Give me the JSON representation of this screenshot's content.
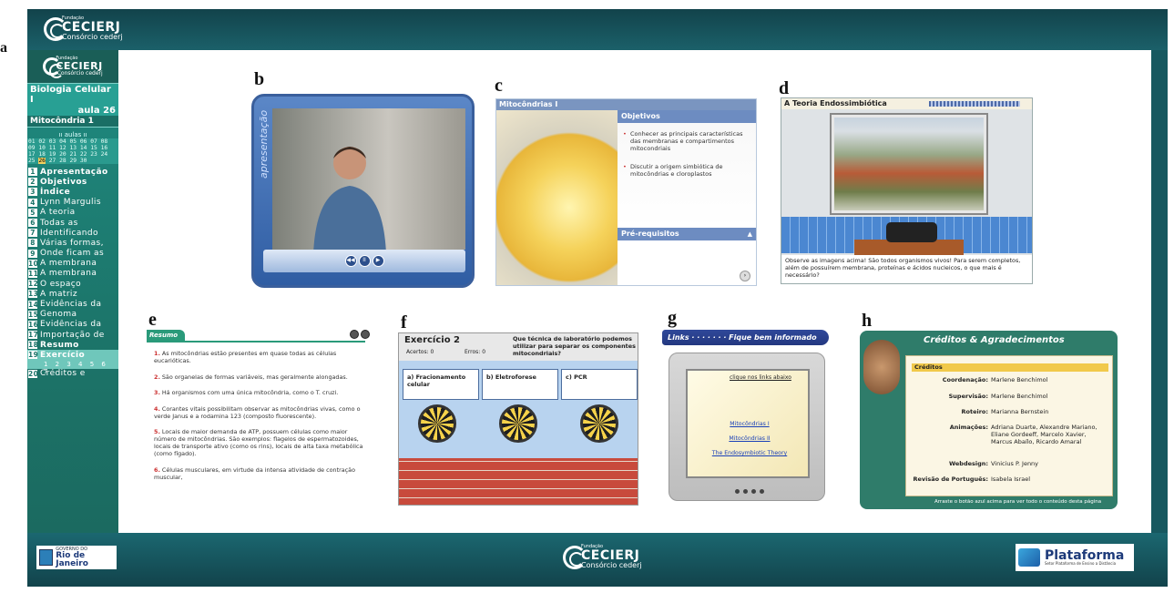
{
  "labels": {
    "a": "a",
    "b": "b",
    "c": "c",
    "d": "d",
    "e": "e",
    "f": "f",
    "g": "g",
    "h": "h"
  },
  "logo": {
    "small": "Fundação",
    "name": "CECIERJ",
    "sub": "Consórcio cederj"
  },
  "sidebar": {
    "course": "Biologia Celular I",
    "lesson": "aula 26",
    "topic": "Mitocôndria 1",
    "aulas_title": "ıı aulas ıı",
    "aulas_rows": [
      "01 02 03 04 05 06 07 08",
      "09 10 11 12 13 14 15 16",
      "17 18 19 20 21 22 23 24"
    ],
    "aulas_last_pre": "25 ",
    "aulas_last_hl": "26",
    "aulas_last_post": " 27 28 29 30",
    "items": [
      {
        "n": "1",
        "label": "Apresentação"
      },
      {
        "n": "2",
        "label": "Objetivos"
      },
      {
        "n": "3",
        "label": "Índice"
      },
      {
        "n": "4",
        "label": "Lynn Margulis"
      },
      {
        "n": "5",
        "label": "A teoria"
      },
      {
        "n": "6",
        "label": "Todas as"
      },
      {
        "n": "7",
        "label": "Identificando"
      },
      {
        "n": "8",
        "label": "Várias formas,"
      },
      {
        "n": "9",
        "label": "Onde ficam as"
      },
      {
        "n": "10",
        "label": "A membrana"
      },
      {
        "n": "11",
        "label": "A membrana"
      },
      {
        "n": "12",
        "label": "O espaço"
      },
      {
        "n": "13",
        "label": "A matriz"
      },
      {
        "n": "14",
        "label": "Evidências da"
      },
      {
        "n": "15",
        "label": "Genoma"
      },
      {
        "n": "16",
        "label": "Evidências da"
      },
      {
        "n": "17",
        "label": "Importação de"
      },
      {
        "n": "18",
        "label": "Resumo"
      },
      {
        "n": "19",
        "label": "Exercício"
      },
      {
        "n": "20",
        "label": "Créditos e"
      }
    ],
    "sub_items": "1 2 3 4 5 6 7"
  },
  "panel_b": {
    "label": "apresentação",
    "controls": [
      "◀◀",
      "II",
      "▶"
    ]
  },
  "panel_c": {
    "header": "Mitocôndrias I",
    "objetivos": "Objetivos",
    "obj1": "Conhecer as principais características das membranas e compartimentos mitocondriais",
    "obj2": "Discutir a origem simbiótica de mitocôndrias e cloroplastos",
    "pre": "Pré-requisitos",
    "arrow": "▲"
  },
  "panel_d": {
    "header": "A Teoria Endossimbiótica",
    "caption": "Observe as imagens acima! São todos organismos vivos! Para serem completos, além de possuírem membrana, proteínas e ácidos nucleicos, o que mais é necessário?"
  },
  "panel_e": {
    "tab": "Resumo",
    "items": [
      {
        "n": "1.",
        "t": "As mitocôndrias estão presentes em quase todas as células eucarióticas."
      },
      {
        "n": "2.",
        "t": "São organelas de formas variáveis, mas geralmente alongadas."
      },
      {
        "n": "3.",
        "t": "Há organismos com uma única mitocôndria, como o T. cruzi."
      },
      {
        "n": "4.",
        "t": "Corantes vitais possibilitam observar as mitocôndrias vivas, como o verde Janus e a rodamina 123 (composto fluorescente)."
      },
      {
        "n": "5.",
        "t": "Locais de maior demanda de ATP, possuem células como maior número de mitocôndrias. São exemplos: flagelos de espermatozoides, locais de transporte ativo (como os rins), locais de alta taxa metabólica (como fígado)."
      },
      {
        "n": "6.",
        "t": "Células musculares, em virtude da intensa atividade de contração muscular,"
      }
    ]
  },
  "panel_f": {
    "title": "Exercício 2",
    "acertos": "Acertos: 0",
    "erros": "Erros: 0",
    "question": "Que técnica de laboratório podemos utilizar para separar os componentes mitocondriais?",
    "options": [
      "a) Fracionamento celular",
      "b) Eletroforese",
      "c) PCR"
    ]
  },
  "panel_g": {
    "banner": "Links · · · · · · · Fique bem informado",
    "top": "clique nos links abaixo",
    "links": [
      "Mitocôndrias I",
      "Mitocôndrias II",
      "The Endosymbiotic Theory"
    ]
  },
  "panel_h": {
    "title": "Créditos & Agradecimentos",
    "section": "Créditos",
    "rows": [
      {
        "k": "Coordenação:",
        "v": "Marlene Benchimol"
      },
      {
        "k": "Supervisão:",
        "v": "Marlene Benchimol"
      },
      {
        "k": "Roteiro:",
        "v": "Marianna Bernstein"
      },
      {
        "k": "Animações:",
        "v": "Adriana Duarte, Alexandre Mariano, Eliane Gordeeff, Marcelo Xavier, Marcus Abaílo, Ricardo Amaral"
      },
      {
        "k": "Webdesign:",
        "v": "Vinicius P. Jenny"
      },
      {
        "k": "Revisão de Português:",
        "v": "Isabela Israel"
      }
    ],
    "footer": "Arraste o botão azul acima para ver todo o conteúdo desta página"
  },
  "footer": {
    "rj_small": "GOVERNO DO",
    "rj": "Rio de Janeiro",
    "plataforma": "Plataforma",
    "plataforma_sub": "Setor Plataforma de Ensino a Distância"
  }
}
